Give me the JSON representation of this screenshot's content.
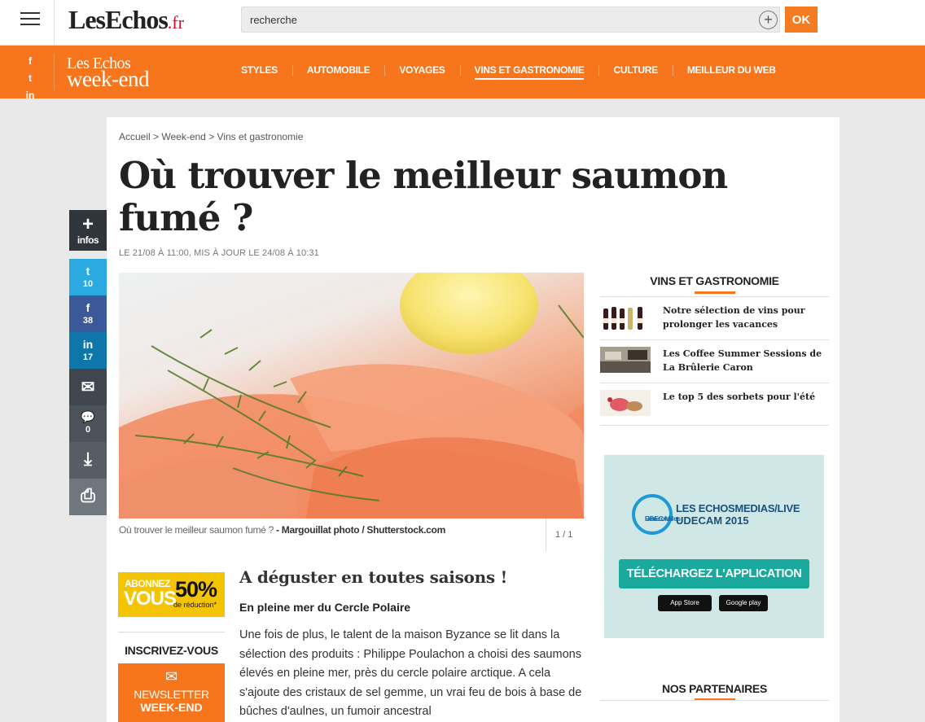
{
  "header": {
    "logo_main": "LesEchos",
    "logo_suffix": ".fr",
    "search_placeholder": "recherche",
    "search_add": "+",
    "ok_label": "OK"
  },
  "weekend_bar": {
    "social": [
      "f",
      "t",
      "in"
    ],
    "logo_line1": "Les Echos",
    "logo_line2": "week-end",
    "nav": [
      "STYLES",
      "AUTOMOBILE",
      "VOYAGES",
      "VINS ET GASTRONOMIE",
      "CULTURE",
      "MEILLEUR DU WEB"
    ],
    "active_nav": "VINS ET GASTRONOMIE"
  },
  "breadcrumb": {
    "items": [
      "Accueil",
      "Week-end",
      "Vins et gastronomie"
    ],
    "separator": " > "
  },
  "article": {
    "title": "Où trouver le meilleur saumon fumé ?",
    "dateline": "LE 21/08 À 11:00, MIS À JOUR LE 24/08 À 10:31",
    "caption": "Où trouver le meilleur saumon fumé ?",
    "caption_credit": "- Margouillat photo / Shutterstock.com",
    "image_counter": "1 / 1",
    "subheading": "A déguster en toutes saisons !",
    "subheading2": "En pleine mer du Cercle Polaire",
    "body": "Une fois de plus, le talent de la maison Byzance se lit dans la sélection des produits : Philippe Poulachon a choisi des saumons élevés en pleine mer, près du cercle polaire arctique. A cela s'ajoute des cristaux de sel gemme, un vrai feu de bois à base de bûches d'aulnes, un fumoir ancestral"
  },
  "share": {
    "plus_symbol": "+",
    "plus_label": "infos",
    "twitter_icon": "t",
    "twitter_count": "10",
    "facebook_icon": "f",
    "facebook_count": "38",
    "linkedin_icon": "in",
    "linkedin_count": "17",
    "mail_icon": "✉",
    "comments_icon": "💬",
    "comments_count": "0",
    "download_icon": "⤓",
    "print_icon": "⎙"
  },
  "promo": {
    "line1": "ABONNEZ",
    "line2": "VOUS",
    "percent": "50%",
    "reduction": "de réduction*"
  },
  "newsletter": {
    "heading": "INSCRIVEZ-VOUS",
    "envelope_icon": "✉",
    "line1": "NEWSLETTER",
    "line2": "WEEK-END"
  },
  "sidebar": {
    "heading": "VINS ET GASTRONOMIE",
    "items": [
      {
        "title": "Notre sélection de vins pour prolonger les vacances"
      },
      {
        "title": "Les Coffee Summer Sessions de La Brûlerie Caron"
      },
      {
        "title": "Le top 5 des sorbets pour l'été"
      }
    ],
    "partners_heading": "NOS PARTENAIRES"
  },
  "ad": {
    "circle_line1": "Les",
    "circle_line2": "Rencontres",
    "circle_line3": "UDECAM",
    "line1": "LES ECHOSMEDIAS/LIVE",
    "line2": "UDECAM 2015",
    "download": "TÉLÉCHARGEZ L'APPLICATION",
    "appstore": "App Store",
    "googleplay": "Google play"
  },
  "colors": {
    "accent": "#f7751c",
    "twitter": "#2ba9e1",
    "facebook": "#3b5998",
    "linkedin": "#0e76a8",
    "promo_yellow": "#f5c400"
  }
}
